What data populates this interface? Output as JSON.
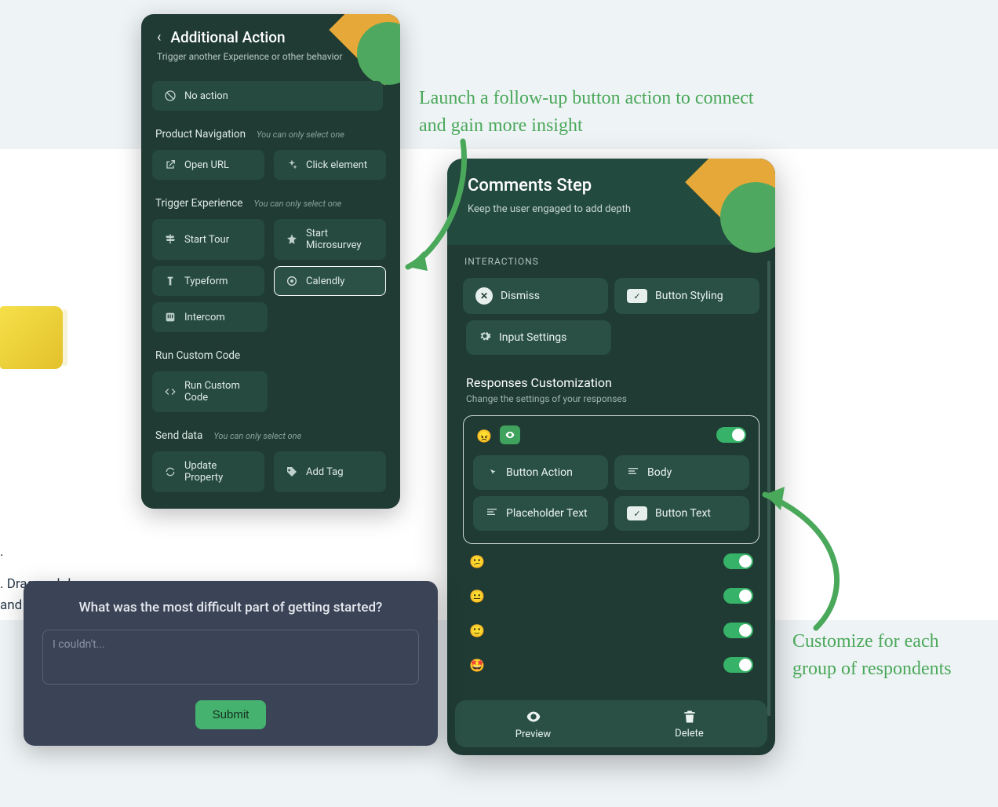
{
  "left_panel": {
    "title": "Additional Action",
    "subtitle": "Trigger another Experience or other behavior",
    "no_action": "No action",
    "sections": {
      "product_nav": {
        "label": "Product Navigation",
        "hint": "You can only select one",
        "open_url": "Open URL",
        "click_element": "Click element"
      },
      "trigger_exp": {
        "label": "Trigger Experience",
        "hint": "You can only select one",
        "start_tour": "Start Tour",
        "start_micro": "Start Microsurvey",
        "typeform": "Typeform",
        "calendly": "Calendly",
        "intercom": "Intercom"
      },
      "run_code": {
        "label": "Run Custom Code",
        "button": "Run Custom Code"
      },
      "send_data": {
        "label": "Send data",
        "hint": "You can only select one",
        "update_prop": "Update Property",
        "add_tag": "Add Tag"
      }
    }
  },
  "right_panel": {
    "title": "Comments Step",
    "subtitle": "Keep the user engaged to add depth",
    "interactions_label": "INTERACTIONS",
    "dismiss": "Dismiss",
    "button_styling": "Button Styling",
    "input_settings": "Input Settings",
    "responses_heading": "Responses Customization",
    "responses_sub": "Change the settings of your responses",
    "actions": {
      "button_action": "Button Action",
      "body": "Body",
      "placeholder_text": "Placeholder Text",
      "button_text": "Button Text"
    },
    "emojis": [
      "😠",
      "😕",
      "😐",
      "🙂",
      "🤩"
    ],
    "footer": {
      "preview": "Preview",
      "delete": "Delete"
    }
  },
  "survey": {
    "question": "What was the most difficult part of getting started?",
    "placeholder": "I couldn't...",
    "submit": "Submit"
  },
  "annotations": {
    "top": "Launch a follow-up button action to connect and gain more insight",
    "right": "Customize for each group of respondents"
  },
  "bg_text_1": ".",
  "bg_text_2": ". Drag and drop",
  "bg_text_3": "and more!"
}
